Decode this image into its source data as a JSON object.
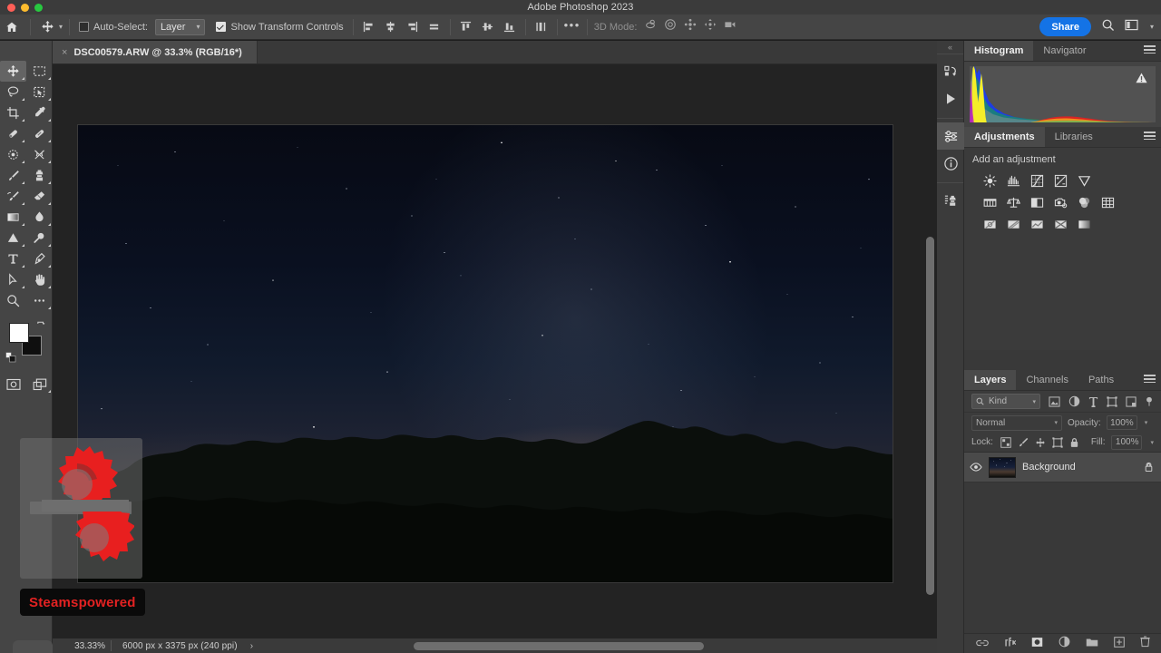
{
  "window": {
    "title": "Adobe Photoshop 2023",
    "traffic_lights": [
      "close",
      "minimize",
      "zoom"
    ]
  },
  "options_bar": {
    "home_icon": "home-icon",
    "tool_icon": "move-tool-icon",
    "auto_select_label": "Auto-Select:",
    "auto_select_checked": false,
    "layer_dropdown_value": "Layer",
    "show_transform_label": "Show Transform Controls",
    "show_transform_checked": true,
    "align_group_1": [
      "align-left-edges-icon",
      "align-horizontal-centers-icon",
      "align-right-edges-icon",
      "distribute-horizontal-icon"
    ],
    "align_group_2": [
      "align-top-edges-icon",
      "align-vertical-centers-icon",
      "align-bottom-edges-icon"
    ],
    "align_group_3": [
      "distribute-vertical-icon"
    ],
    "more_options_label": "•••",
    "mode_3d_label": "3D Mode:",
    "mode_3d_icons": [
      "rotate-3d-icon",
      "roll-3d-icon",
      "pan-3d-icon",
      "slide-3d-icon",
      "camera-3d-icon"
    ],
    "share_label": "Share",
    "search_icon": "search-icon",
    "workspace_icon": "workspace-switcher-icon",
    "workspace_caret": "chevron-down-icon"
  },
  "document_tab": {
    "close_glyph": "×",
    "title": "DSC00579.ARW @ 33.3% (RGB/16*)"
  },
  "toolbar": {
    "tools": [
      {
        "name": "move-tool",
        "glyph": "move",
        "active": true,
        "has_flyout": true
      },
      {
        "name": "rectangular-marquee-tool",
        "glyph": "marquee",
        "active": false,
        "has_flyout": true
      },
      {
        "name": "lasso-tool",
        "glyph": "lasso",
        "active": false,
        "has_flyout": true
      },
      {
        "name": "object-selection-tool",
        "glyph": "objselect",
        "active": false,
        "has_flyout": true
      },
      {
        "name": "crop-tool",
        "glyph": "crop",
        "active": false,
        "has_flyout": true
      },
      {
        "name": "eyedropper-tool",
        "glyph": "eyedropper",
        "active": false,
        "has_flyout": true
      },
      {
        "name": "spot-healing-brush-tool",
        "glyph": "heal",
        "active": false,
        "has_flyout": true
      },
      {
        "name": "brush-tool-alt",
        "glyph": "bandaid",
        "active": false,
        "has_flyout": true
      },
      {
        "name": "patch-tool",
        "glyph": "patch",
        "active": false,
        "has_flyout": true
      },
      {
        "name": "remove-tool",
        "glyph": "remove",
        "active": false,
        "has_flyout": true
      },
      {
        "name": "brush-tool",
        "glyph": "brush",
        "active": false,
        "has_flyout": true
      },
      {
        "name": "clone-stamp-tool",
        "glyph": "stamp",
        "active": false,
        "has_flyout": true
      },
      {
        "name": "history-brush-tool",
        "glyph": "historybrush",
        "active": false,
        "has_flyout": true
      },
      {
        "name": "eraser-tool",
        "glyph": "eraser",
        "active": false,
        "has_flyout": true
      },
      {
        "name": "gradient-tool",
        "glyph": "gradient",
        "active": false,
        "has_flyout": true
      },
      {
        "name": "blur-tool",
        "glyph": "blur",
        "active": false,
        "has_flyout": true
      },
      {
        "name": "dodge-tool",
        "glyph": "dodge",
        "active": false,
        "has_flyout": true
      },
      {
        "name": "burn-tool",
        "glyph": "burn",
        "active": false,
        "has_flyout": true
      },
      {
        "name": "type-tool",
        "glyph": "type",
        "active": false,
        "has_flyout": true
      },
      {
        "name": "pen-tool",
        "glyph": "pen",
        "active": false,
        "has_flyout": true
      },
      {
        "name": "path-selection-tool",
        "glyph": "pathselect",
        "active": false,
        "has_flyout": true
      },
      {
        "name": "hand-tool",
        "glyph": "hand",
        "active": false,
        "has_flyout": true
      },
      {
        "name": "zoom-tool",
        "glyph": "zoom",
        "active": false,
        "has_flyout": false
      },
      {
        "name": "edit-toolbar",
        "glyph": "ellipsis",
        "active": false,
        "has_flyout": true
      }
    ],
    "foreground_color": "#ffffff",
    "background_color": "#0f0f0f",
    "swap_colors_icon": "swap-colors-icon",
    "default_colors_icon": "default-colors-icon",
    "quick_mask_icon": "quick-mask-icon",
    "screen_mode_icon": "screen-mode-icon"
  },
  "canvas": {
    "image_alt": "night sky with milky way over treeline",
    "vertical_scrollbar": "vertical-scrollbar",
    "horizontal_scrollbar": "horizontal-scrollbar"
  },
  "status_bar": {
    "zoom": "33.33%",
    "doc_info": "6000 px x 3375 px (240 ppi)",
    "expand_arrow": "›"
  },
  "rail": {
    "collapse_glyph": "«",
    "groups": [
      [
        {
          "name": "rail-history-icon",
          "selected": false
        },
        {
          "name": "rail-actions-play-icon",
          "selected": false
        }
      ],
      [
        {
          "name": "rail-adjustments-icon",
          "selected": true
        },
        {
          "name": "rail-info-icon",
          "selected": false
        }
      ],
      [
        {
          "name": "rail-clone-source-icon",
          "selected": false
        }
      ]
    ]
  },
  "histogram_panel": {
    "tabs": [
      {
        "label": "Histogram",
        "active": true
      },
      {
        "label": "Navigator",
        "active": false
      }
    ],
    "menu_icon": "panel-menu-icon",
    "warning_icon": "cached-data-warning-icon"
  },
  "adjustments_panel": {
    "tabs": [
      {
        "label": "Adjustments",
        "active": true
      },
      {
        "label": "Libraries",
        "active": false
      }
    ],
    "menu_icon": "panel-menu-icon",
    "hint": "Add an adjustment",
    "rows": [
      [
        "brightness-contrast-icon",
        "levels-icon",
        "curves-icon",
        "exposure-icon",
        "vibrance-icon"
      ],
      [
        "hue-saturation-icon",
        "color-balance-icon",
        "black-white-icon",
        "photo-filter-icon",
        "channel-mixer-icon",
        "color-lookup-icon"
      ],
      [
        "invert-icon",
        "posterize-icon",
        "threshold-icon",
        "selective-color-icon",
        "gradient-map-icon"
      ]
    ]
  },
  "layers_panel": {
    "tabs": [
      {
        "label": "Layers",
        "active": true
      },
      {
        "label": "Channels",
        "active": false
      },
      {
        "label": "Paths",
        "active": false
      }
    ],
    "menu_icon": "panel-menu-icon",
    "filter_placeholder": "Kind",
    "filter_icons": [
      "filter-pixel-icon",
      "filter-adjustment-icon",
      "filter-type-icon",
      "filter-shape-icon",
      "filter-smart-object-icon"
    ],
    "filter_toggle_icon": "filter-enable-toggle-icon",
    "blend_mode": "Normal",
    "opacity_label": "Opacity:",
    "opacity_value": "100%",
    "lock_label": "Lock:",
    "lock_icons": [
      "lock-transparent-pixels-icon",
      "lock-image-pixels-icon",
      "lock-position-icon",
      "lock-artboard-nesting-icon",
      "lock-all-icon"
    ],
    "fill_label": "Fill:",
    "fill_value": "100%",
    "layers": [
      {
        "name": "Background",
        "visible": true,
        "locked": true,
        "thumbnail": "night-sky-thumbnail"
      }
    ],
    "footer_icons": [
      "link-layers-icon",
      "layer-style-fx-icon",
      "add-layer-mask-icon",
      "new-adjustment-layer-icon",
      "new-group-icon",
      "new-layer-icon",
      "delete-layer-icon"
    ]
  },
  "watermark": {
    "text": "Steamspowered",
    "text_color": "#e32222",
    "logo": "gears-logo-icon"
  }
}
